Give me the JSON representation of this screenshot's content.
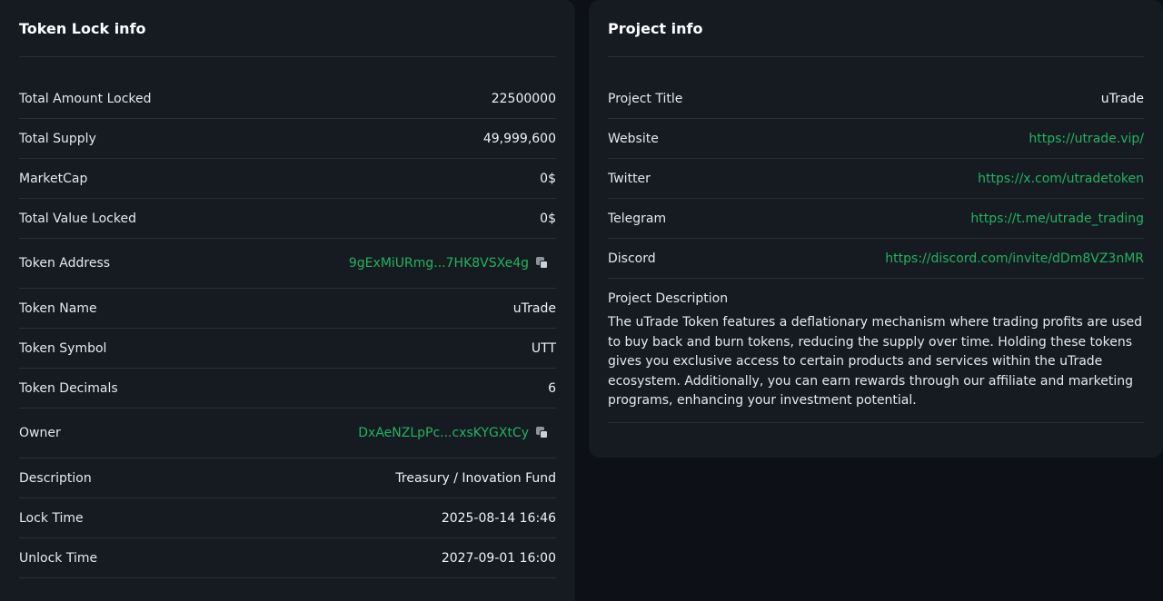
{
  "token_lock": {
    "title": "Token Lock info",
    "rows": [
      {
        "label": "Total Amount Locked",
        "value": "22500000"
      },
      {
        "label": "Total Supply",
        "value": "49,999,600"
      },
      {
        "label": "MarketCap",
        "value": "0$"
      },
      {
        "label": "Total Value Locked",
        "value": "0$"
      },
      {
        "label": "Token Address",
        "value": "9gExMiURmg...7HK8VSXe4g",
        "icon": "copy-icon"
      },
      {
        "label": "Token Name",
        "value": "uTrade"
      },
      {
        "label": "Token Symbol",
        "value": "UTT"
      },
      {
        "label": "Token Decimals",
        "value": "6"
      },
      {
        "label": "Owner",
        "value": "DxAeNZLpPc...cxsKYGXtCy",
        "icon": "copy-icon"
      },
      {
        "label": "Description",
        "value": "Treasury / Inovation Fund"
      },
      {
        "label": "Lock Time",
        "value": "2025-08-14 16:46"
      },
      {
        "label": "Unlock Time",
        "value": "2027-09-01 16:00"
      }
    ]
  },
  "project_info": {
    "title": "Project info",
    "rows": [
      {
        "label": "Project Title",
        "value": "uTrade"
      },
      {
        "label": "Website",
        "value": "https://utrade.vip/"
      },
      {
        "label": "Twitter",
        "value": "https://x.com/utradetoken"
      },
      {
        "label": "Telegram",
        "value": "https://t.me/utrade_trading"
      },
      {
        "label": "Discord",
        "value": "https://discord.com/invite/dDm8VZ3nMR"
      }
    ],
    "description_label": "Project Description",
    "description_text": "The uTrade Token features a deflationary mechanism where trading profits are used to buy back and burn tokens, reducing the supply over time. Holding these tokens gives you exclusive access to certain products and services within the uTrade ecosystem. Additionally, you can earn rewards through our affiliate and marketing programs, enhancing your investment potential."
  },
  "colors": {
    "background": "#0d1117",
    "card": "#161b22",
    "link": "#22b35e",
    "divider": "#2a3038"
  }
}
